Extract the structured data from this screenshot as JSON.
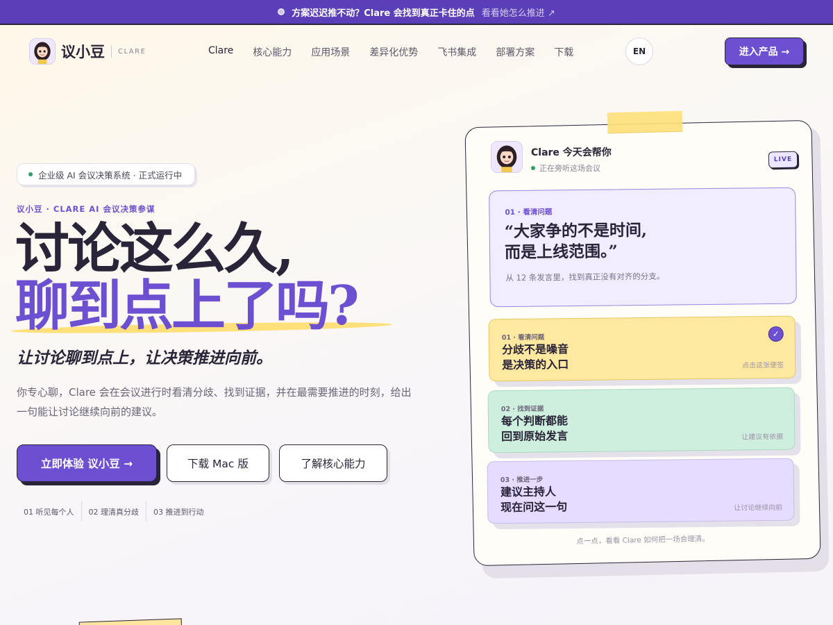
{
  "announcement": {
    "message": "方案迟迟推不动？Clare 会找到真正卡住的点",
    "link": "看看她怎么推进 ↗"
  },
  "nav": {
    "brand": "议小豆",
    "brand_en": "CLARE",
    "items": [
      "Clare",
      "核心能力",
      "应用场景",
      "差异化优势",
      "飞书集成",
      "部署方案",
      "下载"
    ],
    "lang": "EN",
    "cta": "进入产品 →"
  },
  "hero": {
    "badge": "企业级 AI 会议决策系统 · 正式运行中",
    "eyebrow": "议小豆 · CLARE AI 会议决策参谋",
    "title_line1": "讨论这么久,",
    "title_line2": "聊到点上了吗?",
    "subhead": "让讨论聊到点上，让决策推进向前。",
    "description": "你专心聊，Clare 会在会议进行时看清分歧、找到证据，并在最需要推进的时刻，给出一句能让讨论继续向前的建议。",
    "buttons": {
      "primary": "立即体验 议小豆 →",
      "mac": "下载 Mac 版",
      "core": "了解核心能力"
    },
    "steps": [
      "01 听见每个人",
      "02 理清真分歧",
      "03 推进到行动"
    ]
  },
  "clare_card": {
    "title": "Clare 今天会帮你",
    "status": "正在旁听这场会议",
    "live": "LIVE",
    "quote": {
      "label": "01 · 看清问题",
      "line1": "“大家争的不是时间,",
      "line2": "而是上线范围。”",
      "source": "从 12 条发言里，找到真正没有对齐的分支。"
    },
    "cards": [
      {
        "label": "01 · 看清问题",
        "line1": "分歧不是噪音",
        "line2": "是决策的入口",
        "hint": "点击这张便签",
        "checked": true
      },
      {
        "label": "02 · 找到证据",
        "line1": "每个判断都能",
        "line2": "回到原始发言",
        "hint": "让建议有依据"
      },
      {
        "label": "03 · 推进一步",
        "line1": "建议主持人",
        "line2": "现在问这一句",
        "hint": "让讨论继续向前"
      }
    ],
    "footer": "点一点，看看 Clare 如何把一场会理清。"
  },
  "colors": {
    "accent": "#6d4fd2",
    "announcement_bg": "#5b3fb8",
    "highlight": "#ffe07a",
    "card_yellow": "#ffe8a0",
    "card_green": "#ceefde",
    "card_purple": "#e6dcff"
  },
  "icons": {
    "avatar": "girl-avatar-icon",
    "check": "check-icon",
    "status_dot": "live-dot-icon"
  }
}
